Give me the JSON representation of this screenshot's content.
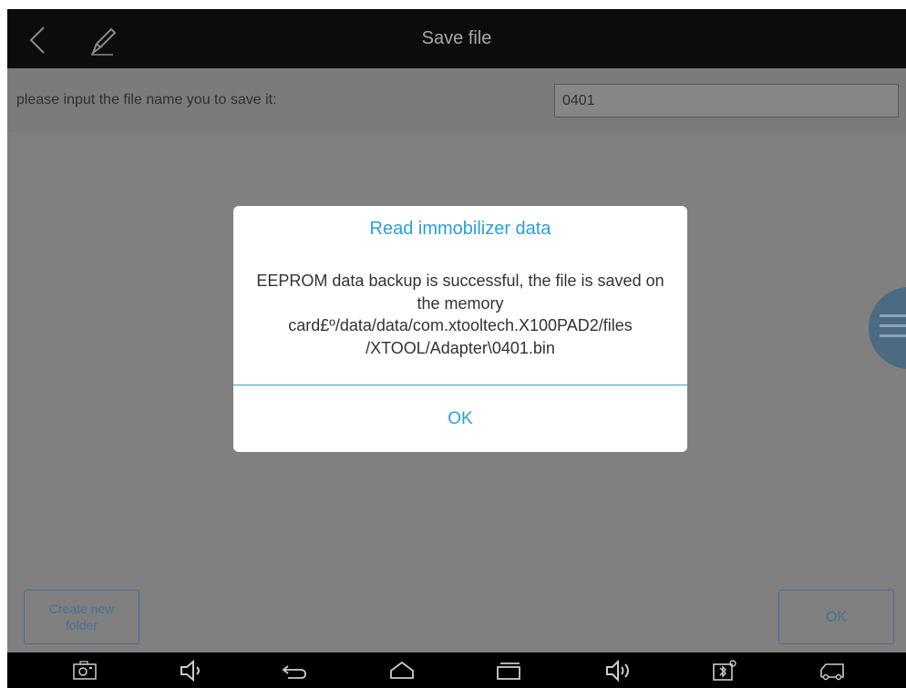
{
  "header": {
    "title": "Save file",
    "back_icon": "chevron-left-icon",
    "edit_icon": "pencil-icon"
  },
  "filename_row": {
    "label": "please input the file name you to save it:",
    "value": "0401"
  },
  "dialog": {
    "title": "Read immobilizer data",
    "message": "EEPROM data backup is successful, the file is saved on the memory card£º/data/data/com.xtooltech.X100PAD2/files /XTOOL/Adapter\\0401.bin",
    "ok_label": "OK"
  },
  "footer": {
    "create_folder_label": "Create new folder",
    "ok_label": "OK"
  },
  "navbar": {
    "icons": [
      "screenshot-icon",
      "volume-down-icon",
      "back-arrow-icon",
      "home-icon",
      "recent-apps-icon",
      "volume-up-icon",
      "bluetooth-status-icon",
      "vci-truck-icon"
    ]
  },
  "colors": {
    "accent": "#2aa0e0",
    "titlebar": "#0c0c0c",
    "overlay": "#808080"
  }
}
